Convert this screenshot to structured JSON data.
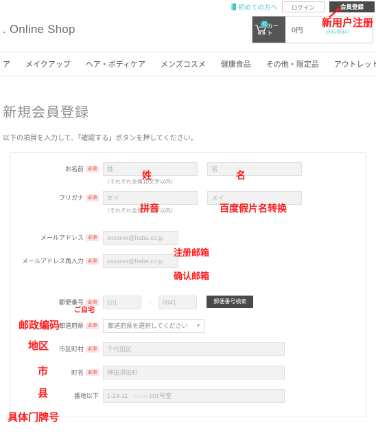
{
  "header": {
    "brand": ". Online Shop",
    "first_time_label": "初めての方へ",
    "login_label": "ログイン",
    "register_label": "会員登録",
    "cart": {
      "icon": "cart-icon",
      "badge_count": "0",
      "label": "カート",
      "price": "0円",
      "free_shipping_text": "5/25(月)まで\n送料無料!"
    }
  },
  "nav": {
    "items": [
      {
        "label": "ア"
      },
      {
        "label": "メイクアップ"
      },
      {
        "label": "ヘア・ボディケア"
      },
      {
        "label": "メンズコスメ"
      },
      {
        "label": "健康食品"
      },
      {
        "label": "その他・限定品"
      },
      {
        "label": "アウトレット"
      }
    ],
    "search_icon": "search-icon"
  },
  "main": {
    "title": "新規会員登録",
    "description": "以下の項目を入力して、「確認する」ボタンを押してください。",
    "required_badge": "必須",
    "form": {
      "name_row": {
        "label": "お名前",
        "required": "必須",
        "last_name_placeholder": "姓",
        "first_name_placeholder": "名",
        "note": "（それぞれ全角10文字以内）"
      },
      "furigana_row": {
        "label": "フリガナ",
        "required": "必須",
        "sei_placeholder": "セイ",
        "mei_placeholder": "メイ",
        "note": "（それぞれ全角10文字以内）"
      },
      "email_row": {
        "label": "メールアドレス",
        "required": "必須",
        "placeholder": "xxxxxxx@haba.co.jp"
      },
      "email_confirm_row": {
        "label": "メールアドレス再入力",
        "required": "必須",
        "placeholder": "xxxxxxx@haba.co.jp"
      },
      "zip_row": {
        "label": "郵便番号",
        "required": "必須",
        "zip1_placeholder": "101",
        "separator": "-",
        "zip2_placeholder": "0041",
        "search_button": "郵便番号検索"
      },
      "prefecture_row": {
        "label": "都道府県",
        "required": "必須",
        "selected": "都道府県を選択してください",
        "chevron": "chevron-down-icon"
      },
      "city_row": {
        "label": "市区町村",
        "required": "必須",
        "placeholder": "千代田区"
      },
      "town_row": {
        "label": "町名",
        "required": "必須",
        "placeholder": "神田須田町"
      },
      "address_row": {
        "label": "番地以下",
        "placeholder": "1-24-11　○○○○101号室"
      }
    }
  },
  "annotations": {
    "register_cn": "新用户注册",
    "last_name_cn": "姓",
    "first_name_cn": "名",
    "pinyin_cn": "拼音",
    "kana_convert_cn": "百度假片名转换",
    "email_cn": "注册邮箱",
    "email_confirm_cn": "确认邮箱",
    "home_jp": "ご自宅",
    "zip_cn": "邮政编码",
    "area_cn": "地区",
    "city_cn": "市",
    "town_cn": "县",
    "address_cn": "具体门牌号"
  },
  "colors": {
    "accent_teal": "#4cc3c7",
    "annotation_red": "#ff1a1a",
    "required_badge_bg": "#fbe3e4",
    "required_badge_text": "#d9534f",
    "dark_button": "#4a4a4a",
    "input_bg": "#f2f2f2"
  }
}
